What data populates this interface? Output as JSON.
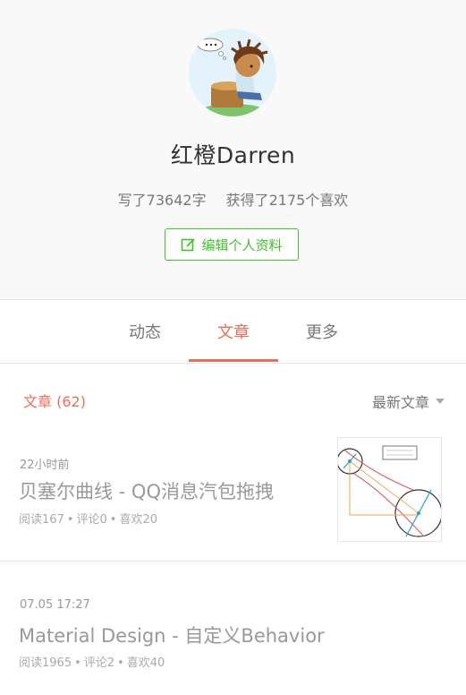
{
  "profile": {
    "username": "红橙Darren",
    "words_written": "写了73642字",
    "likes_received": "获得了2175个喜欢",
    "edit_label": "编辑个人资料"
  },
  "tabs": [
    {
      "label": "动态",
      "active": false
    },
    {
      "label": "文章",
      "active": true
    },
    {
      "label": "更多",
      "active": false
    }
  ],
  "articles_section": {
    "title": "文章 (62)",
    "sort_label": "最新文章"
  },
  "articles": [
    {
      "time": "22小时前",
      "title": "贝塞尔曲线 - QQ消息汽包拖拽",
      "reads": "阅读167",
      "comments": "评论0",
      "likes": "喜欢20",
      "has_thumbnail": true
    },
    {
      "time": "07.05 17:27",
      "title": "Material Design - 自定义Behavior",
      "reads": "阅读1965",
      "comments": "评论2",
      "likes": "喜欢40",
      "has_thumbnail": false
    }
  ],
  "colors": {
    "accent": "#ea6f5a",
    "green": "#42c02e",
    "muted_text": "#999999",
    "divider": "#e6e6e6"
  },
  "icons": {
    "edit": "edit-icon",
    "sort": "caret-down-icon",
    "avatar": "avatar-image"
  }
}
